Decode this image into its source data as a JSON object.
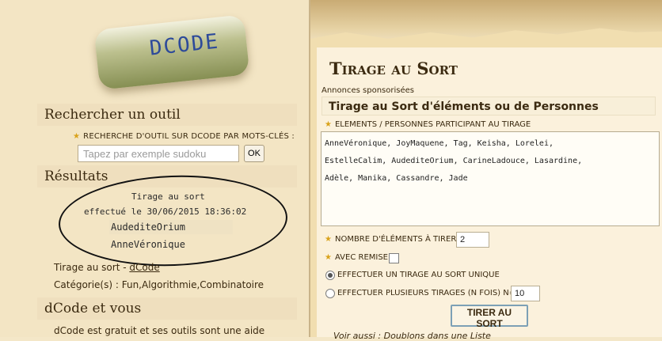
{
  "logo": {
    "text": "DCODE",
    "alt_letters": "EUXPL"
  },
  "search": {
    "heading": "Rechercher un outil",
    "label": "RECHERCHE D'OUTIL SUR DCODE PAR MOTS-CLÉS :",
    "placeholder": "Tapez par exemple sudoku",
    "button": "OK"
  },
  "results": {
    "heading": "Résultats",
    "line1": "Tirage au sort",
    "line2": "effectué le 30/06/2015 18:36:02",
    "items": [
      "AudediteOrium",
      "AnneVéronique"
    ],
    "tool_label": "Tirage au sort - ",
    "tool_link": "dCode",
    "categories": "Catégorie(s) : Fun,Algorithmie,Combinatoire"
  },
  "about": {
    "heading": "dCode et vous",
    "text": "dCode est gratuit et ses outils sont une aide"
  },
  "page": {
    "title": "Tirage au Sort",
    "sponsor": "Annonces sponsorisées",
    "subtitle": "Tirage au Sort d'éléments ou de Personnes",
    "elements_label": "ELEMENTS / PERSONNES PARTICIPANT AU TIRAGE",
    "elements_text": "AnneVéronique, JoyMaquene, Tag, Keisha, Lorelei,\nEstelleCalim, AudediteOrium, CarineLadouce, Lasardine,\nAdèle, Manika, Cassandre, Jade",
    "count_label": "NOMBRE D'ÉLÉMENTS À TIRER",
    "count_value": "2",
    "replace_label": "AVEC REMISE",
    "single_label": "EFFECTUER UN TIRAGE AU SORT UNIQUE",
    "multi_label": "EFFECTUER PLUSIEURS TIRAGES (N FOIS) N=",
    "multi_value": "10",
    "submit": "TIRER AU SORT",
    "see_also": "Voir aussi : Doublons dans une Liste"
  }
}
